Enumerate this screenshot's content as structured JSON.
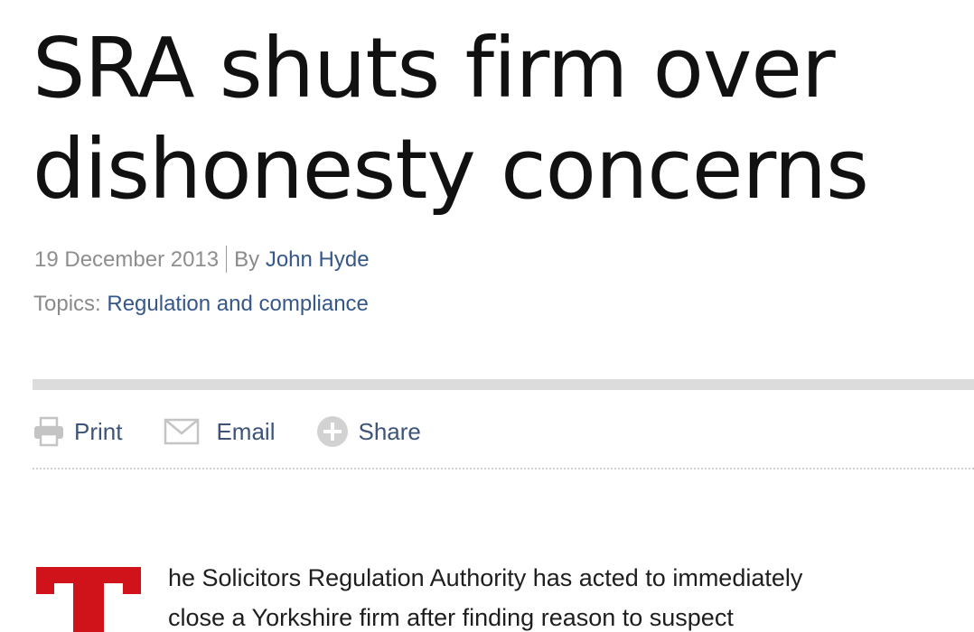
{
  "article": {
    "headline": {
      "line1": "SRA shuts firm over",
      "line2": "dishonesty concerns"
    },
    "date": "19 December 2013",
    "byline_prefix": "By",
    "author": "John Hyde",
    "topics_label": "Topics:",
    "topic": "Regulation and compliance",
    "dropcap_letter": "T",
    "dropcap_color": "#d0121b",
    "body_lines": [
      "he Solicitors Regulation Authority has acted to immediately",
      "close a Yorkshire firm after finding reason to suspect"
    ]
  },
  "share_bar": {
    "print": {
      "label": "Print",
      "icon": "printer-icon"
    },
    "email": {
      "label": "Email",
      "icon": "envelope-icon"
    },
    "share": {
      "label": "Share",
      "icon": "plus-circle-icon"
    }
  },
  "colors": {
    "link": "#35578a",
    "meta_gray": "#8a8a8a",
    "icon_gray": "#c4c4c4",
    "rule_gray": "#dcdcdc"
  }
}
